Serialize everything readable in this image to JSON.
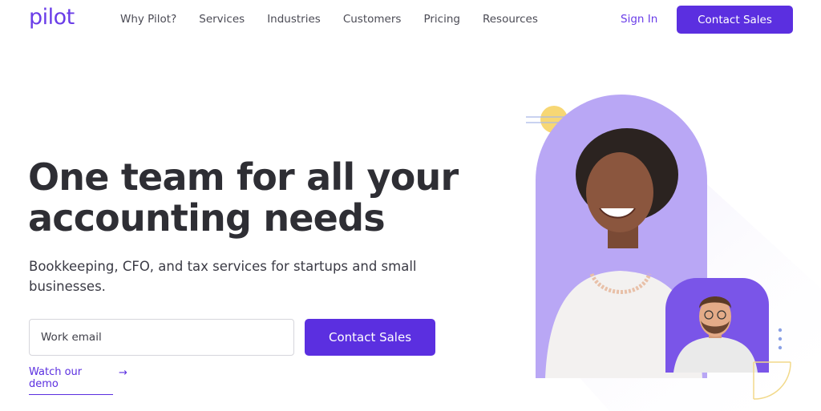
{
  "brand": {
    "logo_text": "pilot",
    "accent_color": "#5b2fe0",
    "secondary_color": "#b9a7f5"
  },
  "nav": {
    "links": [
      {
        "label": "Why Pilot?"
      },
      {
        "label": "Services"
      },
      {
        "label": "Industries"
      },
      {
        "label": "Customers"
      },
      {
        "label": "Pricing"
      },
      {
        "label": "Resources"
      }
    ],
    "sign_in": "Sign In",
    "cta": "Contact Sales"
  },
  "hero": {
    "headline_line1": "One team for all your",
    "headline_line2": "accounting needs",
    "subhead": "Bookkeeping, CFO, and tax services for startups and small businesses.",
    "email_placeholder": "Work email",
    "cta": "Contact Sales",
    "demo_link": "Watch our demo",
    "demo_arrow_icon": "arrow-right-icon"
  },
  "illustration": {
    "main_photo": "smiling woman with curly gray hair",
    "secondary_photo": "smiling man with glasses"
  }
}
